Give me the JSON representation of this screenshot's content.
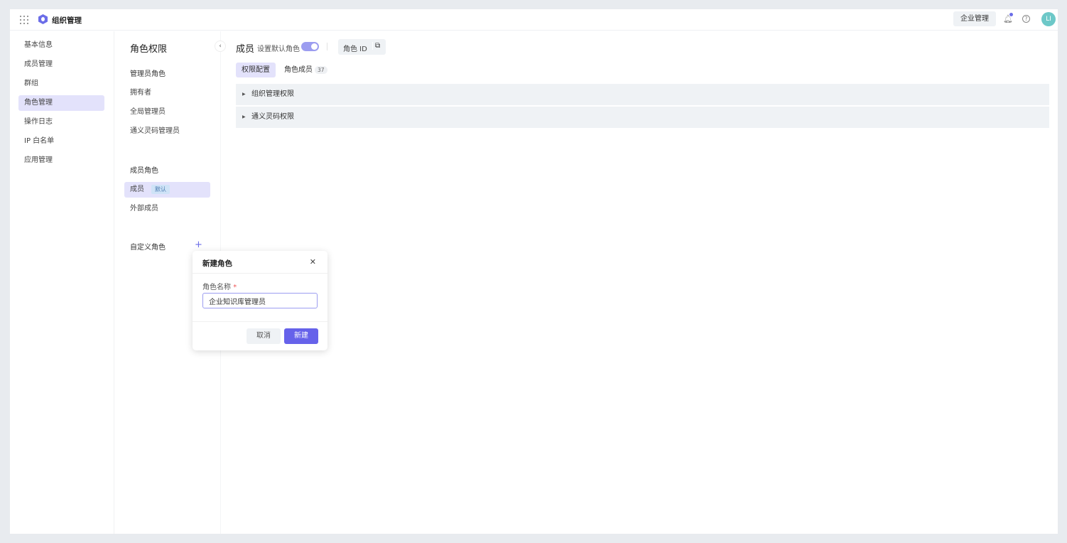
{
  "header": {
    "title": "组织管理",
    "enterprise_button": "企业管理",
    "avatar_initials": "LI",
    "icons": [
      "grid-icon",
      "logo-icon",
      "bell-icon",
      "help-icon"
    ]
  },
  "nav": {
    "items": [
      {
        "label": "基本信息"
      },
      {
        "label": "成员管理"
      },
      {
        "label": "群组"
      },
      {
        "label": "角色管理",
        "active": true
      },
      {
        "label": "操作日志"
      },
      {
        "label": "IP 白名单"
      },
      {
        "label": "应用管理"
      }
    ]
  },
  "roles": {
    "title": "角色权限",
    "admin_group": "管理员角色",
    "admin_roles": [
      "拥有者",
      "全局管理员",
      "通义灵码管理员"
    ],
    "member_group": "成员角色",
    "member_roles": [
      {
        "label": "成员",
        "badge": "默认",
        "active": true
      },
      {
        "label": "外部成员"
      }
    ],
    "custom_group": "自定义角色"
  },
  "main": {
    "title": "成员",
    "set_default_label": "设置默认角色",
    "set_default_on": true,
    "role_id_label": "角色 ID",
    "tabs": [
      {
        "label": "权限配置",
        "active": true
      },
      {
        "label": "角色成员",
        "count": "37"
      }
    ],
    "sections": [
      "组织管理权限",
      "通义灵码权限"
    ]
  },
  "dialog": {
    "title": "新建角色",
    "field_label": "角色名称",
    "required_mark": "*",
    "field_value": "企业知识库管理员",
    "cancel": "取消",
    "confirm": "新建"
  },
  "colors": {
    "accent": "#6662ea",
    "active_bg": "#e3e2fb"
  }
}
